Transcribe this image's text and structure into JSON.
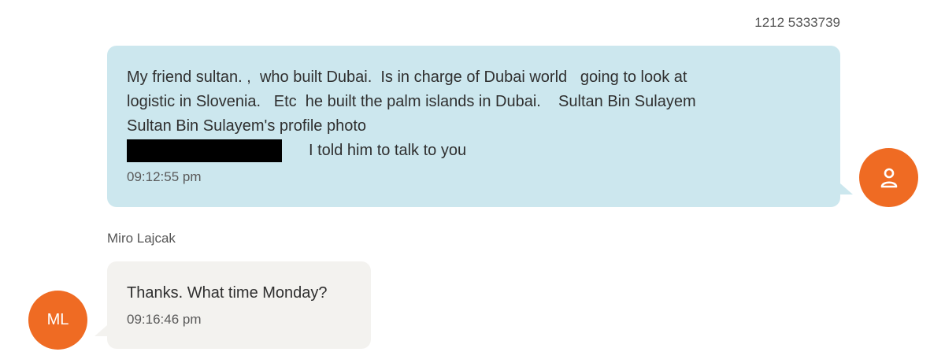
{
  "outgoing": {
    "sender": "1212 5333739",
    "lines": [
      "My friend sultan. ,  who built Dubai.  Is in charge of Dubai world   going to look at",
      "logistic in Slovenia.   Etc  he built the palm islands in Dubai.    Sultan Bin Sulayem",
      "Sultan Bin Sulayem's profile photo"
    ],
    "redacted_line_text": "I told him to talk to you",
    "time": "09:12:55 pm",
    "avatar_icon": "person-icon",
    "avatar_color": "#ef6b23",
    "bubble_color": "#cce7ee"
  },
  "incoming": {
    "sender": "Miro Lajcak",
    "text": "Thanks. What time Monday?",
    "time": "09:16:46 pm",
    "avatar_initials": "ML",
    "avatar_color": "#ef6b23",
    "bubble_color": "#f3f2ef"
  }
}
